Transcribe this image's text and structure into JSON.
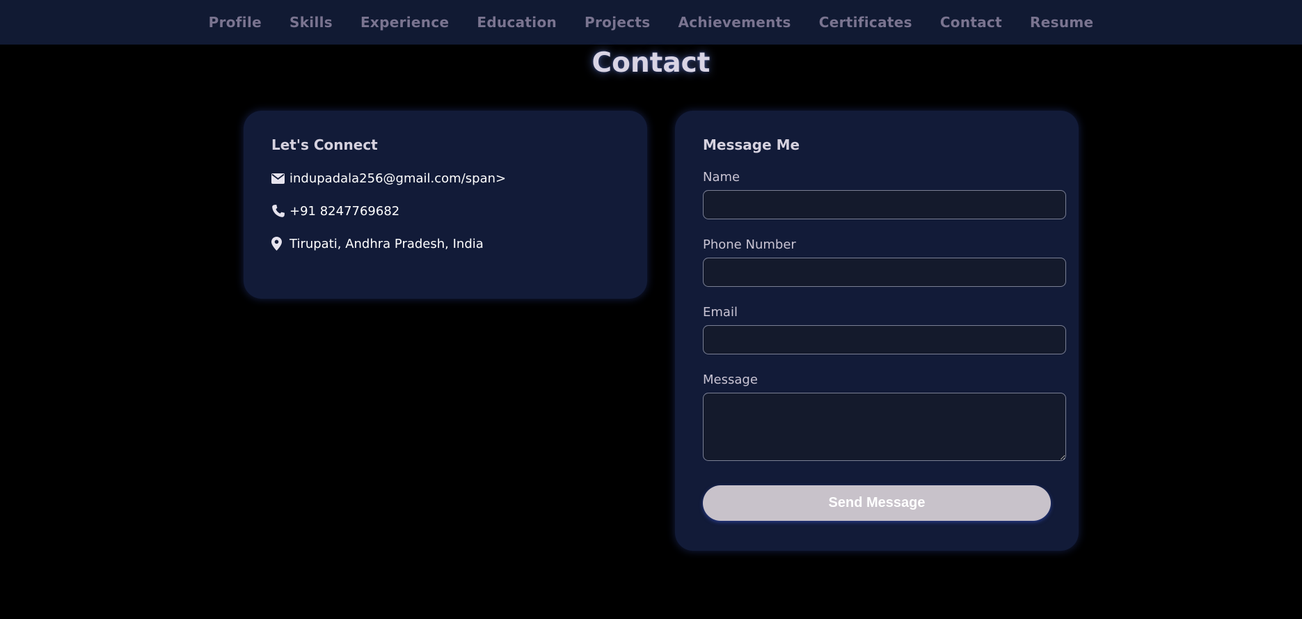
{
  "nav": {
    "items": [
      {
        "label": "Profile"
      },
      {
        "label": "Skills"
      },
      {
        "label": "Experience"
      },
      {
        "label": "Education"
      },
      {
        "label": "Projects"
      },
      {
        "label": "Achievements"
      },
      {
        "label": "Certificates"
      },
      {
        "label": "Contact"
      },
      {
        "label": "Resume"
      }
    ]
  },
  "page": {
    "title": "Contact"
  },
  "connect": {
    "title": "Let's Connect",
    "email": {
      "icon": "envelope-icon",
      "text": "indupadala256@gmail.com/span>"
    },
    "phone": {
      "icon": "phone-icon",
      "text": "+91 8247769682"
    },
    "location": {
      "icon": "map-pin-icon",
      "text": "Tirupati, Andhra Pradesh, India"
    }
  },
  "message_form": {
    "title": "Message Me",
    "fields": {
      "name": {
        "label": "Name",
        "value": ""
      },
      "phone": {
        "label": "Phone Number",
        "value": ""
      },
      "email": {
        "label": "Email",
        "value": ""
      },
      "message": {
        "label": "Message",
        "value": ""
      }
    },
    "submit_label": "Send Message"
  },
  "colors": {
    "background": "#000000",
    "navbar": "#111a33",
    "card": "#121b38",
    "nav_text": "#7a7490",
    "button": "#c8c2ca"
  }
}
